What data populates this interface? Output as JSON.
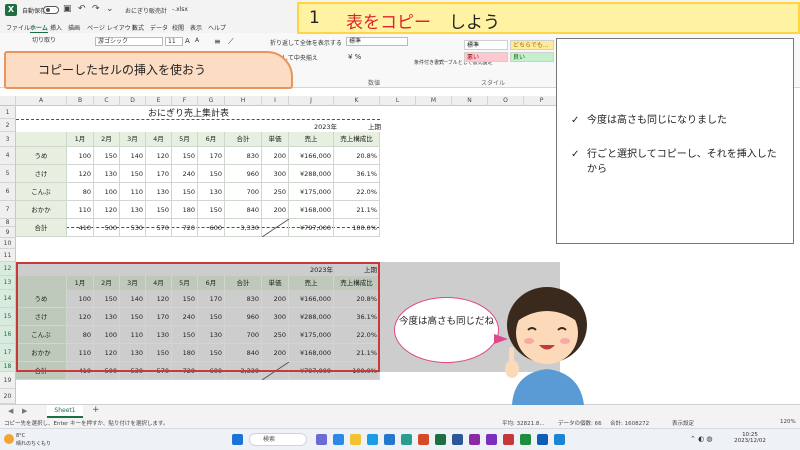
{
  "app": {
    "autosave_label": "自動保存",
    "autosave_state": "オフ",
    "file_name": "おにぎり販売計",
    "file_ext": "-.xlsx"
  },
  "menu": [
    "ファイル",
    "ホーム",
    "挿入",
    "描画",
    "ページ レイアウト",
    "数式",
    "データ",
    "校閲",
    "表示",
    "ヘルプ"
  ],
  "menu_active": "ホーム",
  "ribbon": {
    "cut": "切り取り",
    "font_name": "游ゴシック",
    "font_size": "11",
    "wrap_text": "折り返して全体を表示する",
    "merge_center": "結合して中央揃え",
    "number_format": "標準",
    "cond_format": "条件付き書式",
    "table_format": "テーブルとして書式設定",
    "number_group": "数値",
    "style_group": "スタイル",
    "styles": {
      "standard": "標準",
      "neutral": "どちらでも...",
      "bad": "悪い",
      "good": "良い"
    }
  },
  "grid": {
    "columns": [
      "A",
      "B",
      "C",
      "D",
      "E",
      "F",
      "G",
      "H",
      "I",
      "J",
      "K",
      "L",
      "M",
      "N",
      "O",
      "P"
    ],
    "rows": [
      "1",
      "2",
      "3",
      "4",
      "5",
      "6",
      "7",
      "8",
      "9",
      "10",
      "11",
      "12",
      "13",
      "14",
      "15",
      "16",
      "17",
      "18",
      "19",
      "20"
    ]
  },
  "sheet": {
    "title": "おにぎり売上集計表",
    "year": "2023年",
    "period": "上期",
    "headers": [
      "1月",
      "2月",
      "3月",
      "4月",
      "5月",
      "6月",
      "合計",
      "単価",
      "売上",
      "売上構成比"
    ],
    "rows": [
      {
        "name": "うめ",
        "values": [
          "100",
          "150",
          "140",
          "120",
          "150",
          "170",
          "830",
          "200",
          "¥166,000",
          "20.8%"
        ]
      },
      {
        "name": "さけ",
        "values": [
          "120",
          "130",
          "150",
          "170",
          "240",
          "150",
          "960",
          "300",
          "¥288,000",
          "36.1%"
        ]
      },
      {
        "name": "こんぶ",
        "values": [
          "80",
          "100",
          "110",
          "130",
          "150",
          "130",
          "700",
          "250",
          "¥175,000",
          "22.0%"
        ]
      },
      {
        "name": "おかか",
        "values": [
          "110",
          "120",
          "130",
          "150",
          "180",
          "150",
          "840",
          "200",
          "¥168,000",
          "21.1%"
        ]
      },
      {
        "name": "合計",
        "values": [
          "410",
          "500",
          "530",
          "570",
          "720",
          "600",
          "3,330",
          "",
          "¥797,000",
          "100.0%"
        ]
      }
    ]
  },
  "sheet_tabs": {
    "active": "Sheet1",
    "add": "+"
  },
  "status": {
    "message": "コピー先を選択し、Enter キーを押すか、貼り付けを選択します。",
    "average": "平均: 32821.8...",
    "count": "データの個数: 66",
    "sum": "合計: 1608272",
    "display_settings": "表示設定",
    "zoom": "120%"
  },
  "taskbar": {
    "weather_temp": "8°C",
    "weather_text": "晴れのちくもり",
    "search_placeholder": "検索",
    "time": "10:25",
    "date": "2023/12/02"
  },
  "slide": {
    "number": "1",
    "title_red": "表をコピー",
    "title_black": "しよう",
    "subtitle": "コピーしたセルの挿入を使おう",
    "notes": [
      "今度は高さも同じになりました",
      "行ごと選択してコピーし、それを挿入したから"
    ],
    "bubble": "今度は高さも同じだね"
  },
  "colors": {
    "excel_green": "#1d6f42",
    "title_red": "#d9262c",
    "title_bar": "#fff3a3",
    "subtitle_fill": "#fcdcc2",
    "selection_border": "#c83a3a",
    "bubble_border": "#e2478b"
  }
}
